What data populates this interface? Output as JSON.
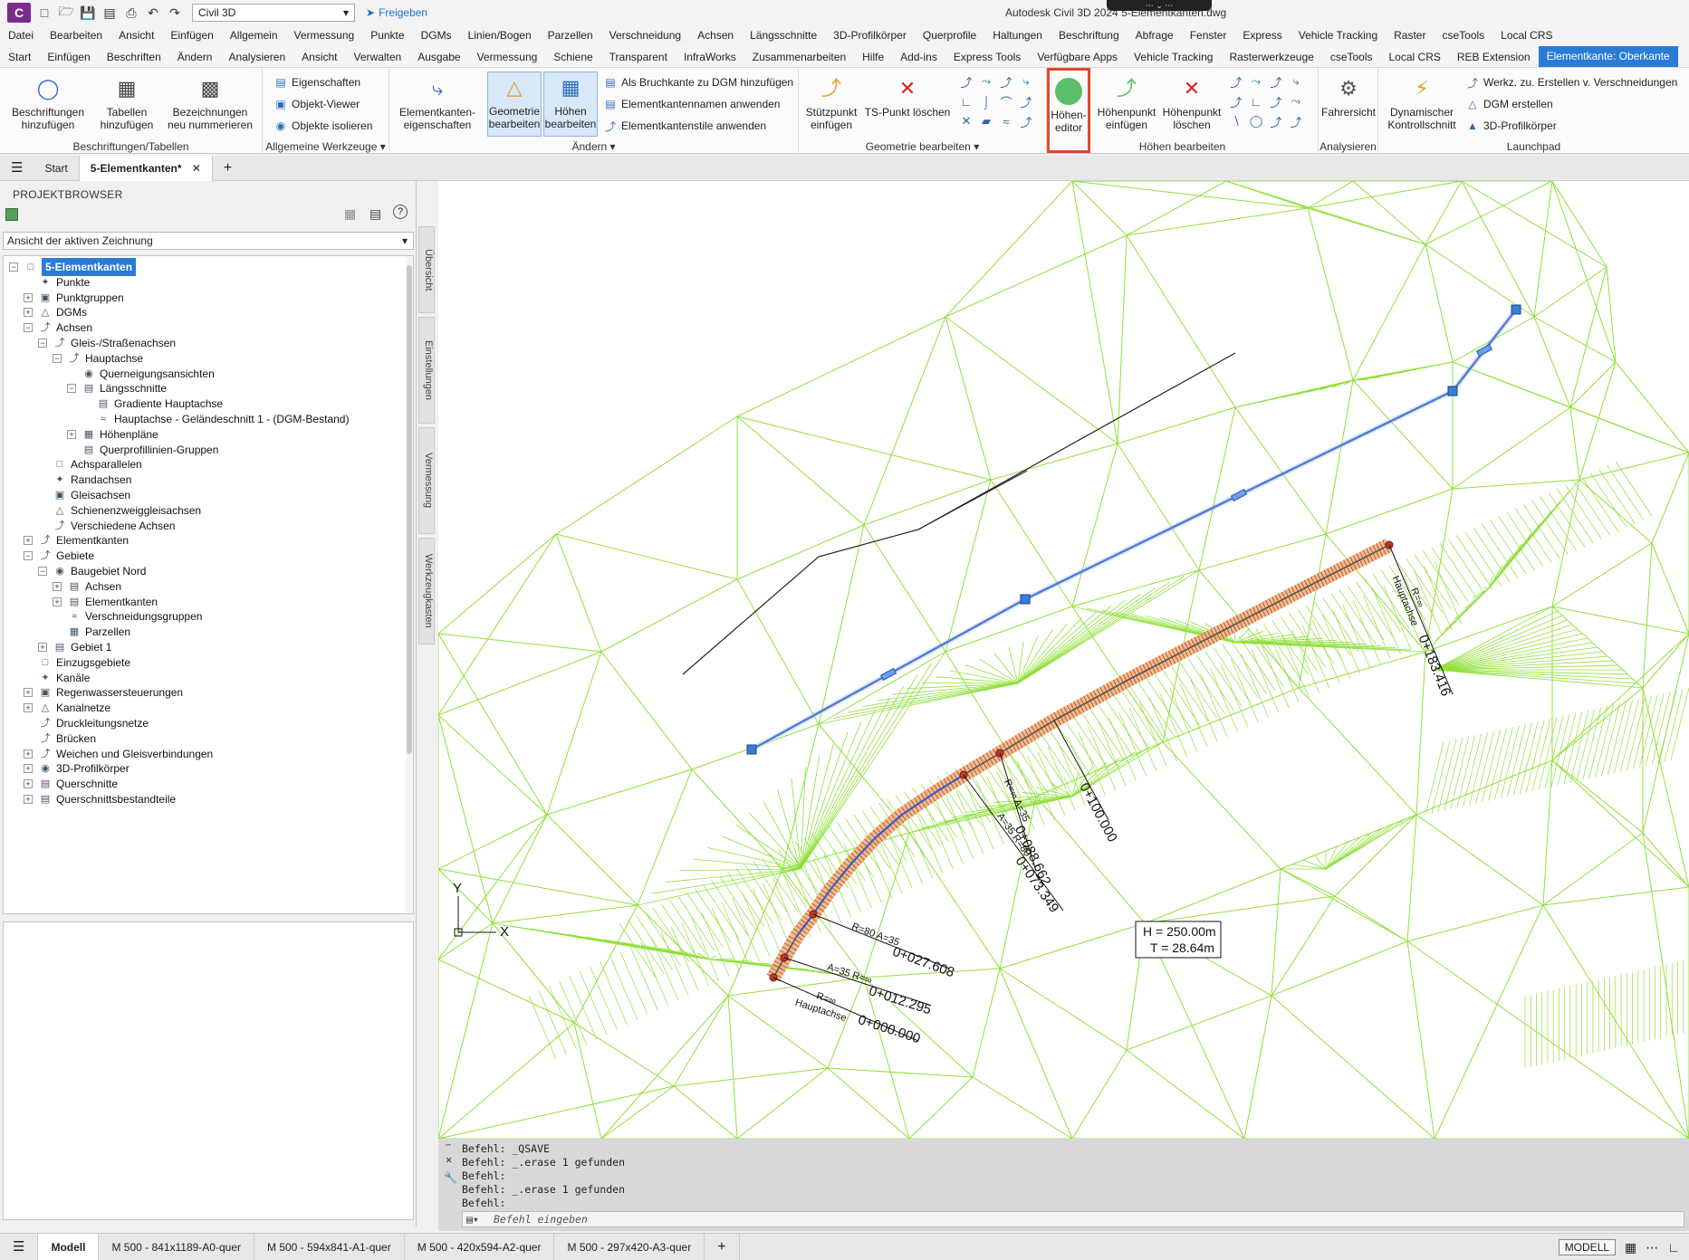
{
  "title_bar": {
    "app_logo": "C",
    "workspace": "Civil 3D",
    "share": "Freigeben",
    "app_title": "Autodesk Civil 3D 2024   5-Elementkanten.dwg"
  },
  "menu_primary": [
    "Datei",
    "Bearbeiten",
    "Ansicht",
    "Einfügen",
    "Allgemein",
    "Vermessung",
    "Punkte",
    "DGMs",
    "Linien/Bogen",
    "Parzellen",
    "Verschneidung",
    "Achsen",
    "Längsschnitte",
    "3D-Profilkörper",
    "Querprofile",
    "Haltungen",
    "Beschriftung",
    "Abfrage",
    "Fenster",
    "Express",
    "Vehicle Tracking",
    "Raster",
    "cseTools",
    "Local CRS"
  ],
  "menu_ribbon_tabs": [
    "Start",
    "Einfügen",
    "Beschriften",
    "Ändern",
    "Analysieren",
    "Ansicht",
    "Verwalten",
    "Ausgabe",
    "Vermessung",
    "Schiene",
    "Transparent",
    "InfraWorks",
    "Zusammenarbeiten",
    "Hilfe",
    "Add-ins",
    "Express Tools",
    "Verfügbare Apps",
    "Vehicle Tracking",
    "Rasterwerkzeuge",
    "cseTools",
    "Local CRS",
    "REB Extension",
    "Elementkante: Oberkante"
  ],
  "ribbon": {
    "labels_panel": {
      "title": "Beschriftungen/Tabellen",
      "add_labels": "Beschriftungen hinzufügen",
      "add_tables": "Tabellen hinzufügen",
      "renumber": "Bezeichnungen neu nummerieren"
    },
    "general_panel": {
      "title": "Allgemeine Werkzeuge",
      "properties": "Eigenschaften",
      "object_viewer": "Objekt-Viewer",
      "isolate": "Objekte isolieren"
    },
    "modify_panel": {
      "title": "Ändern",
      "fl_properties": "Elementkanten-eigenschaften",
      "edit_geometry": "Geometrie bearbeiten",
      "edit_elevations": "Höhen bearbeiten",
      "add_breakline": "Als Bruchkante zu DGM hinzufügen",
      "apply_names": "Elementkantennamen anwenden",
      "apply_styles": "Elementkantenstile anwenden"
    },
    "geometry_panel": {
      "title": "Geometrie bearbeiten",
      "insert_pi": "Stützpunkt einfügen",
      "delete_pi": "TS-Punkt löschen"
    },
    "elevation_panel": {
      "title": "Höhen bearbeiten",
      "elev_editor": "Höhen-editor",
      "insert_elev_point": "Höhenpunkt einfügen",
      "delete_elev_point": "Höhenpunkt löschen"
    },
    "analyze_panel": {
      "title": "Analysieren",
      "drive": "Fahrersicht"
    },
    "launchpad_panel": {
      "title": "Launchpad",
      "dynamic_check": "Dynamischer Kontrollschnitt",
      "tools_create": "Werkz. zu. Erstellen v. Verschneidungen",
      "create_dgm": "DGM erstellen",
      "corridor": "3D-Profilkörper"
    }
  },
  "doc_tabs": {
    "start": "Start",
    "active": "5-Elementkanten*"
  },
  "browser": {
    "title": "PROJEKTBROWSER",
    "view_select": "Ansicht der aktiven Zeichnung",
    "vertical_tabs": [
      "Übersicht",
      "Einstellungen",
      "Vermessung",
      "Werkzeugkasten"
    ],
    "tree": [
      {
        "label": "5-Elementkanten",
        "level": 0,
        "exp": "-",
        "sel": true
      },
      {
        "label": "Punkte",
        "level": 1,
        "exp": ""
      },
      {
        "label": "Punktgruppen",
        "level": 1,
        "exp": "+"
      },
      {
        "label": "DGMs",
        "level": 1,
        "exp": "+"
      },
      {
        "label": "Achsen",
        "level": 1,
        "exp": "-"
      },
      {
        "label": "Gleis-/Straßenachsen",
        "level": 2,
        "exp": "-"
      },
      {
        "label": "Hauptachse",
        "level": 3,
        "exp": "-"
      },
      {
        "label": "Querneigungsansichten",
        "level": 4,
        "exp": ""
      },
      {
        "label": "Längsschnitte",
        "level": 4,
        "exp": "-"
      },
      {
        "label": "Gradiente Hauptachse",
        "level": 5,
        "exp": ""
      },
      {
        "label": "Hauptachse - Geländeschnitt 1 - (DGM-Bestand)",
        "level": 5,
        "exp": ""
      },
      {
        "label": "Höhenpläne",
        "level": 4,
        "exp": "+"
      },
      {
        "label": "Querprofillinien-Gruppen",
        "level": 4,
        "exp": ""
      },
      {
        "label": "Achsparallelen",
        "level": 2,
        "exp": ""
      },
      {
        "label": "Randachsen",
        "level": 2,
        "exp": ""
      },
      {
        "label": "Gleisachsen",
        "level": 2,
        "exp": ""
      },
      {
        "label": "Schienenzweiggleisachsen",
        "level": 2,
        "exp": ""
      },
      {
        "label": "Verschiedene Achsen",
        "level": 2,
        "exp": ""
      },
      {
        "label": "Elementkanten",
        "level": 1,
        "exp": "+"
      },
      {
        "label": "Gebiete",
        "level": 1,
        "exp": "-"
      },
      {
        "label": "Baugebiet Nord",
        "level": 2,
        "exp": "-"
      },
      {
        "label": "Achsen",
        "level": 3,
        "exp": "+"
      },
      {
        "label": "Elementkanten",
        "level": 3,
        "exp": "+"
      },
      {
        "label": "Verschneidungsgruppen",
        "level": 3,
        "exp": ""
      },
      {
        "label": "Parzellen",
        "level": 3,
        "exp": ""
      },
      {
        "label": "Gebiet 1",
        "level": 2,
        "exp": "+"
      },
      {
        "label": "Einzugsgebiete",
        "level": 1,
        "exp": ""
      },
      {
        "label": "Kanäle",
        "level": 1,
        "exp": ""
      },
      {
        "label": "Regenwassersteuerungen",
        "level": 1,
        "exp": "+"
      },
      {
        "label": "Kanalnetze",
        "level": 1,
        "exp": "+"
      },
      {
        "label": "Druckleitungsnetze",
        "level": 1,
        "exp": ""
      },
      {
        "label": "Brücken",
        "level": 1,
        "exp": ""
      },
      {
        "label": "Weichen und Gleisverbindungen",
        "level": 1,
        "exp": "+"
      },
      {
        "label": "3D-Profilkörper",
        "level": 1,
        "exp": "+"
      },
      {
        "label": "Querschnitte",
        "level": 1,
        "exp": "+"
      },
      {
        "label": "Querschnittsbestandteile",
        "level": 1,
        "exp": "+"
      }
    ]
  },
  "drawing": {
    "stations": [
      {
        "station": "0+000.000",
        "params": "R=∞",
        "name": "Hauptachse"
      },
      {
        "station": "0+012.295",
        "params": "A=35  R=∞"
      },
      {
        "station": "0+027.608",
        "params": "R=80  A=35"
      },
      {
        "station": "0+073.349",
        "params": "A=35  R=80"
      },
      {
        "station": "0+088.662",
        "params": "R=∞  A=35"
      },
      {
        "station": "0+100.000"
      },
      {
        "station": "0+183.416",
        "params": "R=∞",
        "name": "Hauptachse"
      }
    ],
    "scale_h": "H = 250.00m",
    "scale_t": "T = 28.64m",
    "ucs_x": "X",
    "ucs_y": "Y"
  },
  "command_history": [
    "Befehl: _QSAVE",
    "Befehl: _.erase 1 gefunden",
    "Befehl:",
    "Befehl: _.erase 1 gefunden",
    "Befehl:"
  ],
  "command_placeholder": "Befehl eingeben",
  "layout_tabs": [
    "Modell",
    "M 500 - 841x1189-A0-quer",
    "M 500 - 594x841-A1-quer",
    "M 500 - 420x594-A2-quer",
    "M 500 - 297x420-A3-quer"
  ],
  "status": {
    "mode": "MODELL"
  },
  "colors": {
    "tin": "#8fe03a",
    "accent": "#2a7bd6",
    "highlight": "#e24b2a"
  }
}
